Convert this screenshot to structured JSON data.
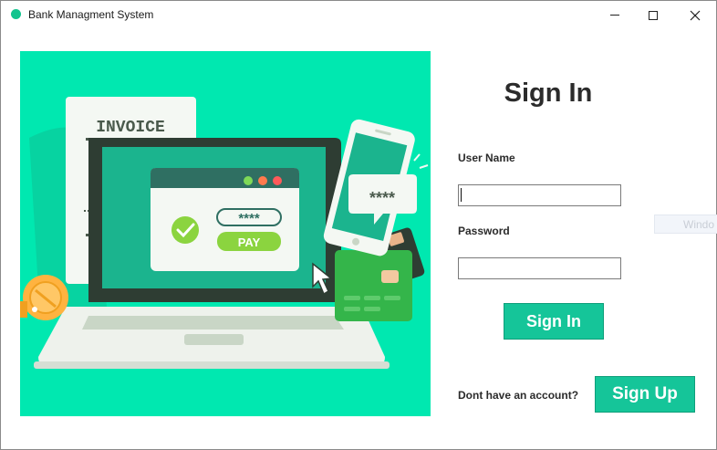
{
  "window": {
    "title": "Bank Managment System",
    "icon": "green-dot-icon",
    "controls": [
      "minimize-icon",
      "maximize-icon",
      "close-icon"
    ]
  },
  "illustration": {
    "invoice_label": "INVOICE",
    "card_password_mask": "****",
    "pay_label": "PAY",
    "phone_password_mask": "****"
  },
  "form": {
    "title": "Sign In",
    "username_label": "User Name",
    "username_value": "",
    "password_label": "Password",
    "password_value": "",
    "signin_label": "Sign In",
    "account_prompt": "Dont have an account?",
    "signup_label": "Sign Up"
  },
  "background_window": {
    "label": "Windo"
  },
  "colors": {
    "accent": "#15c599",
    "illustration_bg": "#00e8b0",
    "app_icon": "#11c48e"
  }
}
